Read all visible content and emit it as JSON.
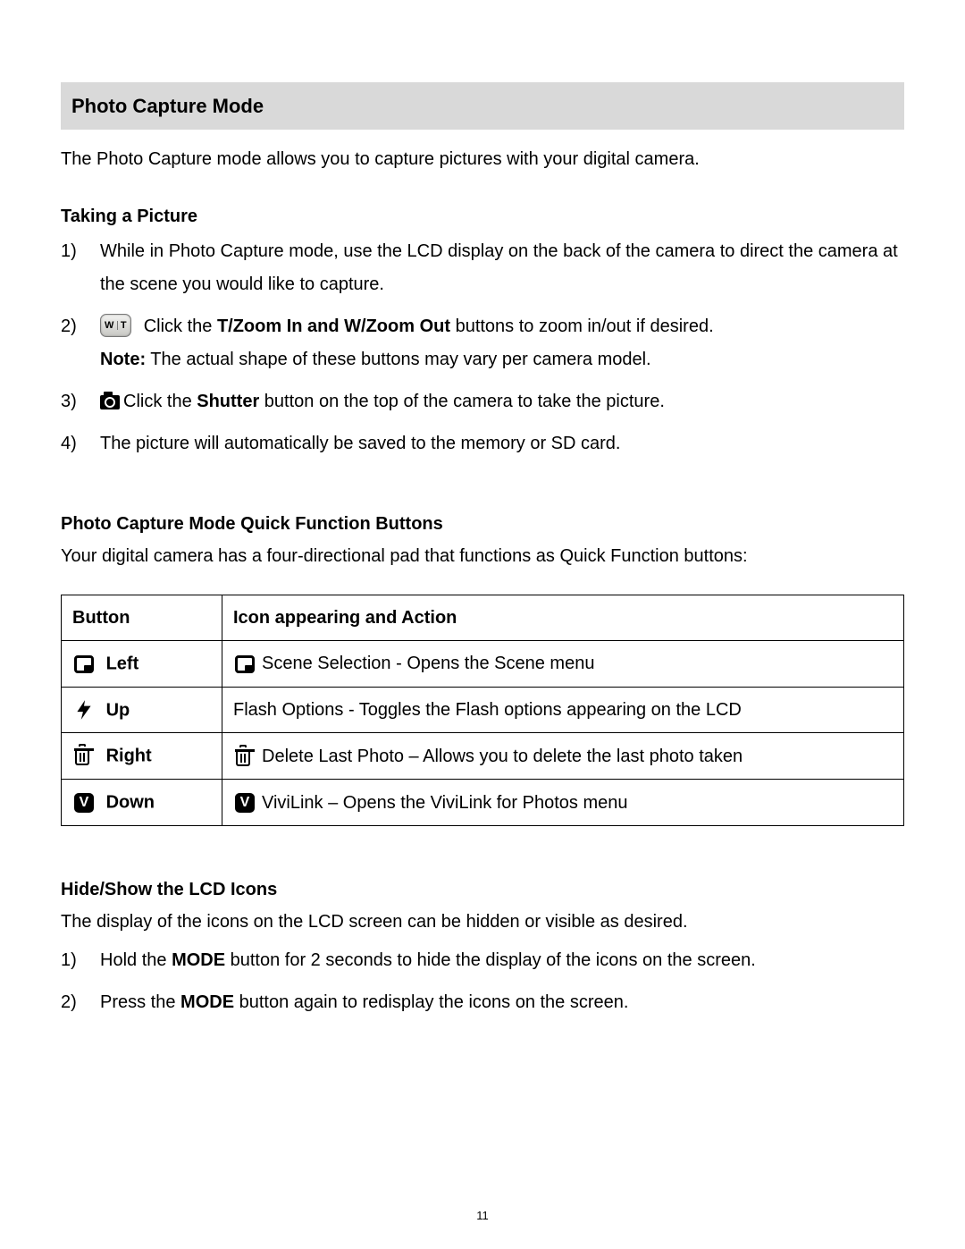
{
  "heading": "Photo Capture Mode",
  "intro": "The Photo Capture mode allows you to capture pictures with your digital camera.",
  "taking": {
    "title": "Taking a Picture",
    "items": {
      "n1": "1)",
      "t1": "While in Photo Capture mode, use the LCD display on the back of the camera to direct the camera at the scene you would like to capture.",
      "n2": "2)",
      "wt_w": "W",
      "wt_t": "T",
      "t2a": "Click the ",
      "t2b": "T/Zoom In and W/Zoom Out",
      "t2c": " buttons to zoom in/out if desired.",
      "note_label": "Note:",
      "note_text": " The actual shape of these buttons may vary per camera model.",
      "n3": "3)",
      "t3a": "Click the ",
      "t3b": "Shutter",
      "t3c": " button on the top of the camera to take the picture.",
      "n4": "4)",
      "t4": "The picture will automatically be saved to the memory or SD card."
    }
  },
  "qf": {
    "title": "Photo Capture Mode Quick Function Buttons",
    "intro": "Your digital camera has a four-directional pad that functions as Quick Function buttons:",
    "header_button": "Button",
    "header_action": "Icon appearing and Action",
    "rows": [
      {
        "label": "Left",
        "icon": "scene",
        "action": "Scene Selection - Opens the Scene menu"
      },
      {
        "label": "Up",
        "icon": "flash",
        "action": "Flash Options - Toggles the Flash options appearing on the LCD"
      },
      {
        "label": "Right",
        "icon": "trash",
        "action": "Delete Last Photo – Allows you to delete the last photo taken"
      },
      {
        "label": "Down",
        "icon": "v",
        "action": "ViviLink – Opens the ViviLink for Photos menu"
      }
    ]
  },
  "hideshow": {
    "title": "Hide/Show the LCD Icons",
    "intro": "The display of the icons on the LCD screen can be hidden or visible as desired.",
    "n1": "1)",
    "t1a": "Hold the ",
    "t1b": "MODE",
    "t1c": " button for 2 seconds to hide the display of the icons on the screen.",
    "n2": "2)",
    "t2a": "Press the ",
    "t2b": "MODE",
    "t2c": " button again to redisplay the icons on the screen."
  },
  "page_number": "11"
}
